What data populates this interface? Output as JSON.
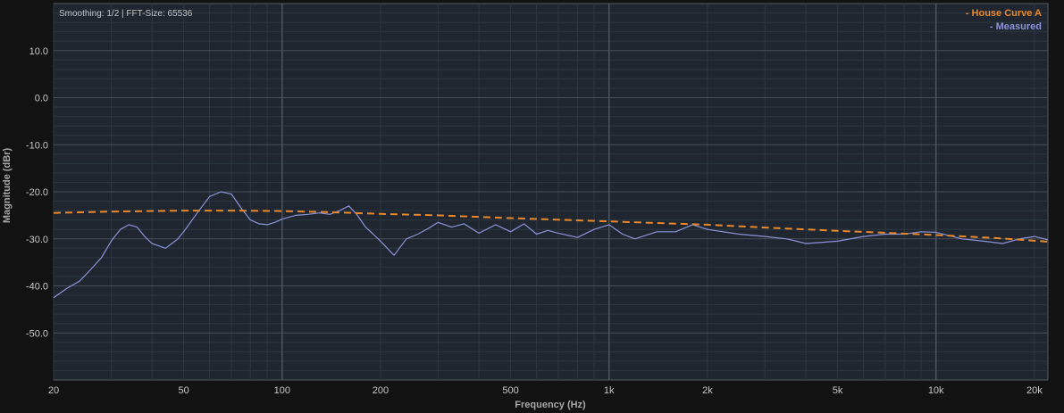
{
  "chart_data": {
    "type": "line",
    "info_text": "Smoothing: 1/2 | FFT-Size: 65536",
    "xlabel": "Frequency (Hz)",
    "ylabel": "Magnitude (dBr)",
    "x_scale": "log",
    "xlim": [
      20,
      22000
    ],
    "ylim": [
      -60,
      20
    ],
    "grid": true,
    "legend_position": "top-right",
    "x_ticks": [
      {
        "value": 20,
        "label": "20"
      },
      {
        "value": 50,
        "label": "50"
      },
      {
        "value": 100,
        "label": "100"
      },
      {
        "value": 200,
        "label": "200"
      },
      {
        "value": 500,
        "label": "500"
      },
      {
        "value": 1000,
        "label": "1k"
      },
      {
        "value": 2000,
        "label": "2k"
      },
      {
        "value": 5000,
        "label": "5k"
      },
      {
        "value": 10000,
        "label": "10k"
      },
      {
        "value": 20000,
        "label": "20k"
      }
    ],
    "y_ticks": [
      {
        "value": 10,
        "label": "10.0"
      },
      {
        "value": 0,
        "label": "0.0"
      },
      {
        "value": -10,
        "label": "-10.0"
      },
      {
        "value": -20,
        "label": "-20.0"
      },
      {
        "value": -30,
        "label": "-30.0"
      },
      {
        "value": -40,
        "label": "-40.0"
      },
      {
        "value": -50,
        "label": "-50.0"
      }
    ],
    "series": [
      {
        "name": "House Curve A",
        "color": "#e8882a",
        "style": "dashed",
        "x": [
          20,
          30,
          50,
          70,
          100,
          150,
          200,
          300,
          500,
          1000,
          2000,
          3000,
          5000,
          7000,
          10000,
          15000,
          22000
        ],
        "y": [
          -24.5,
          -24.2,
          -24.0,
          -24.0,
          -24.1,
          -24.4,
          -24.7,
          -25.0,
          -25.6,
          -26.3,
          -27.0,
          -27.6,
          -28.3,
          -28.7,
          -29.2,
          -29.8,
          -30.6
        ]
      },
      {
        "name": "Measured",
        "color": "#8c93d8",
        "style": "solid",
        "x": [
          20,
          22,
          24,
          26,
          28,
          30,
          32,
          34,
          36,
          38,
          40,
          42,
          44,
          46,
          48,
          50,
          55,
          60,
          65,
          70,
          75,
          80,
          85,
          90,
          95,
          100,
          110,
          120,
          130,
          140,
          150,
          160,
          170,
          180,
          190,
          200,
          220,
          240,
          260,
          280,
          300,
          330,
          360,
          400,
          450,
          500,
          550,
          600,
          650,
          700,
          800,
          900,
          1000,
          1100,
          1200,
          1400,
          1600,
          1800,
          2000,
          2500,
          3000,
          3500,
          4000,
          5000,
          6000,
          7000,
          8000,
          9000,
          10000,
          12000,
          14000,
          16000,
          18000,
          20000,
          22000
        ],
        "y": [
          -42.5,
          -40.5,
          -39.0,
          -36.5,
          -34.0,
          -30.5,
          -28.0,
          -27.0,
          -27.5,
          -29.5,
          -31.0,
          -31.5,
          -32.0,
          -31.0,
          -30.0,
          -28.5,
          -24.5,
          -21.0,
          -20.0,
          -20.5,
          -23.5,
          -26.0,
          -26.8,
          -27.0,
          -26.5,
          -25.8,
          -25.0,
          -24.8,
          -24.5,
          -24.8,
          -24.0,
          -23.0,
          -25.0,
          -27.5,
          -29.0,
          -30.5,
          -33.5,
          -30.0,
          -29.0,
          -27.8,
          -26.5,
          -27.5,
          -26.8,
          -28.8,
          -27.0,
          -28.5,
          -26.8,
          -29.0,
          -28.2,
          -28.8,
          -29.7,
          -28.0,
          -27.0,
          -29.0,
          -30.0,
          -28.5,
          -28.5,
          -27.0,
          -28.0,
          -29.0,
          -29.5,
          -30.0,
          -31.0,
          -30.5,
          -29.5,
          -29.0,
          -29.0,
          -28.5,
          -28.6,
          -30.0,
          -30.5,
          -31.0,
          -30.0,
          -29.5,
          -30.2
        ]
      }
    ]
  }
}
